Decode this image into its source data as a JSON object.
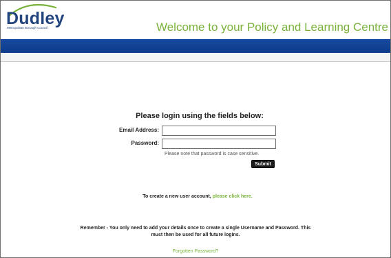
{
  "header": {
    "logo_text": "Dudley",
    "logo_subtitle": "Metropolitan Borough Council",
    "site_title": "Welcome to your Policy and Learning Centre"
  },
  "login": {
    "heading": "Please login using the fields below:",
    "email_label": "Email Address:",
    "email_value": "",
    "password_label": "Password:",
    "password_value": "",
    "case_note": "Please note that password is case sensitive.",
    "submit_label": "Submit"
  },
  "register": {
    "prompt": "To create a new user account,",
    "link_text": "please click here."
  },
  "remember": {
    "line1": "Remember - You only need to add your details once to create a single Username and Password. This",
    "line2": "must then be used for all future logins."
  },
  "forgot": {
    "link_text": "Forgotten Password?"
  },
  "colors": {
    "brand_blue": "#22457e",
    "nav_bar": "#174aa0",
    "accent_green": "#79b23a",
    "button_black": "#1c1c1c"
  }
}
